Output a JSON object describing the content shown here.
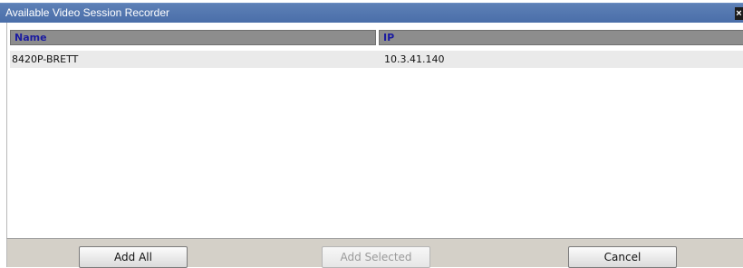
{
  "window": {
    "title": "Available Video Session Recorder",
    "close_glyph": "×"
  },
  "table": {
    "columns": [
      "Name",
      "IP"
    ],
    "rows": [
      {
        "name": "8420P-BRETT",
        "ip": "10.3.41.140"
      }
    ]
  },
  "buttons": {
    "add_all": "Add All",
    "add_selected": "Add Selected",
    "add_selected_enabled": false,
    "cancel": "Cancel"
  },
  "colors": {
    "titlebar": "#4a6ea9",
    "header_bg": "#8d8d8d",
    "header_text": "#1a1aa0",
    "row_bg": "#eaeaea",
    "footer_bg": "#d4d0c8"
  }
}
